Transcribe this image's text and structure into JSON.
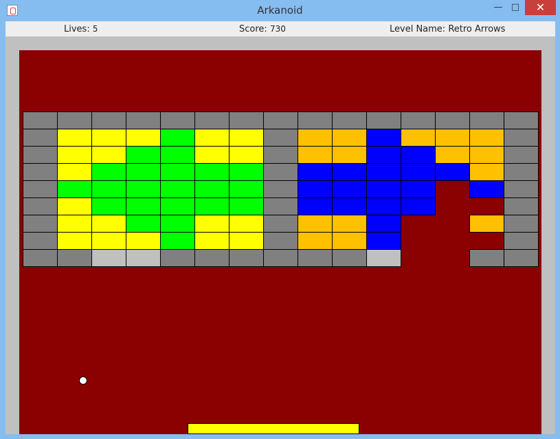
{
  "window": {
    "title": "Arkanoid"
  },
  "status": {
    "lives_label": "Lives:",
    "lives_value": "5",
    "score_label": "Score:",
    "score_value": "730",
    "level_label": "Level Name:",
    "level_value": "Retro Arrows"
  },
  "colors": {
    "G": "#808080",
    "L": "#c0c0c0",
    "Y": "#ffff00",
    "N": "#00ff00",
    "O": "#ffc000",
    "B": "#0000ff",
    "field": "#8b0000",
    "frame": "#c0c0c0",
    "paddle": "#ffff00",
    "ball": "#ffffff"
  },
  "bricks": [
    "GGGGGGGGGGGGGGG",
    "GYYYNYYGOOBOOOG",
    "GYYNNYYGOOBBOOG",
    "GYNNNNNGBBBBBOG",
    "GNNNNNNGBBBB.BG",
    "GYNNNNNGBBBB..G",
    "GYYNNYYGOOB..OG",
    "GYYYNYYGOOB...G",
    "GGLLGGGGGGL..GG"
  ]
}
